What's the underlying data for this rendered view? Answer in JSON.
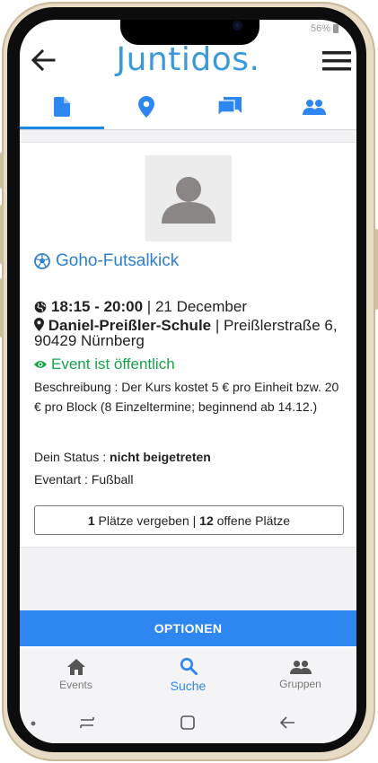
{
  "status_bar": {
    "battery_text": "56%"
  },
  "header": {
    "logo": "Juntidos."
  },
  "tabs": [
    {
      "name": "details",
      "icon": "document-icon",
      "active": true
    },
    {
      "name": "location",
      "icon": "location-pin-icon",
      "active": false
    },
    {
      "name": "chat",
      "icon": "chat-icon",
      "active": false
    },
    {
      "name": "members",
      "icon": "people-icon",
      "active": false
    }
  ],
  "event": {
    "title": "Goho-Futsalkick",
    "time_range": "18:15 - 20:00",
    "date": " | 21 December",
    "venue": "Daniel-Preißler-Schule",
    "address": " | Preißlerstraße 6, 90429 Nürnberg",
    "visibility": "Event ist öffentlich",
    "description": "Beschreibung : Der Kurs kostet 5 € pro Einheit bzw. 20 € pro Block (8 Einzeltermine; beginnend ab 14.12.)",
    "status_label": "Dein Status : ",
    "status_value": "nicht beigetreten",
    "type_label": "Eventart : ",
    "type_value": "Fußball",
    "places_taken": "1",
    "places_taken_text": " Plätze vergeben | ",
    "places_open": "12",
    "places_open_text": " offene Plätze"
  },
  "options_label": "OPTIONEN",
  "bottom_nav": [
    {
      "label": "Events",
      "icon": "home-icon",
      "active": false
    },
    {
      "label": "Suche",
      "icon": "search-icon",
      "active": true
    },
    {
      "label": "Gruppen",
      "icon": "group-icon",
      "active": false
    }
  ],
  "colors": {
    "accent": "#2e86f0",
    "logo": "#3a9ad9",
    "public_green": "#17a34a",
    "title_blue": "#2f7fd1"
  }
}
